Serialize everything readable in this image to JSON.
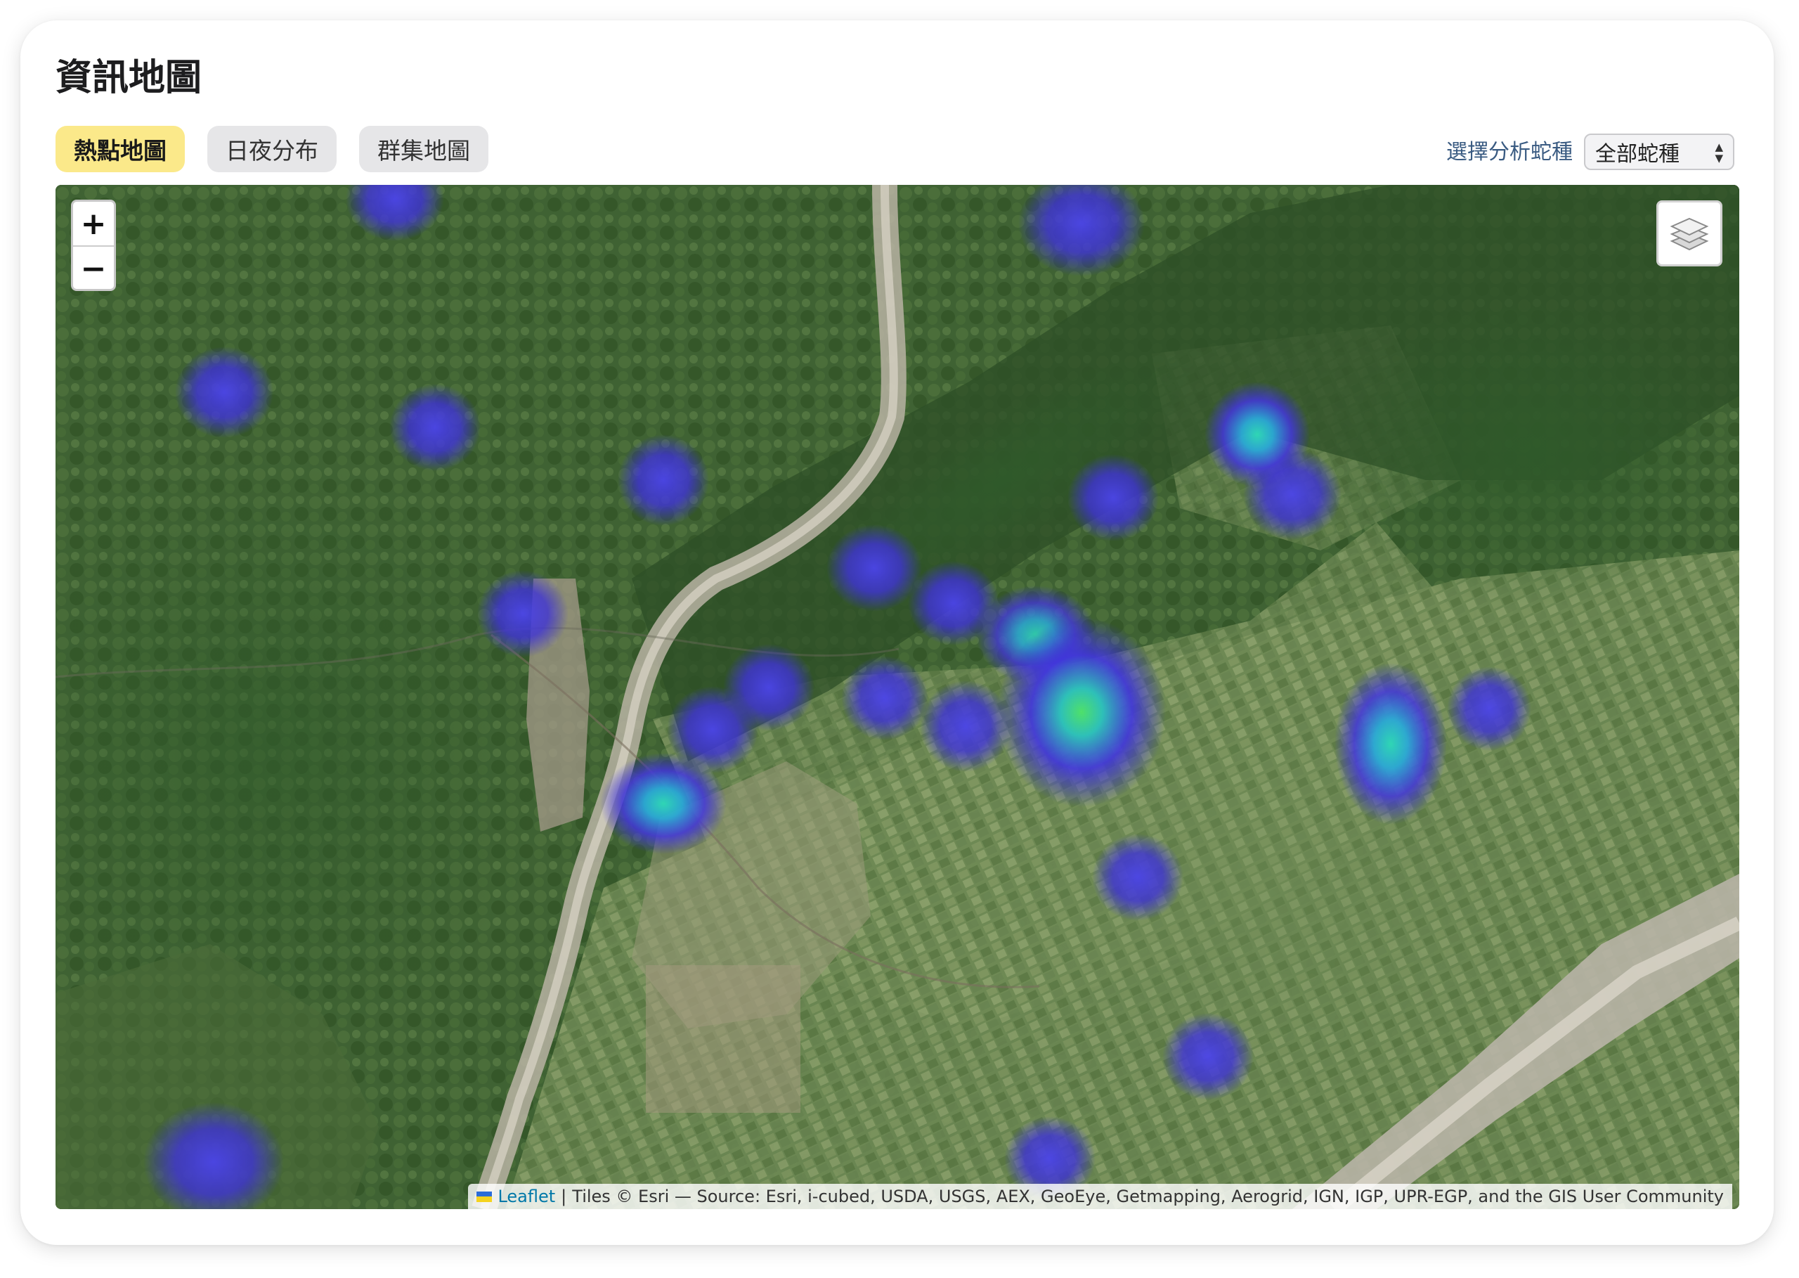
{
  "page": {
    "title": "資訊地圖"
  },
  "tabs": [
    {
      "label": "熱點地圖",
      "active": true
    },
    {
      "label": "日夜分布",
      "active": false
    },
    {
      "label": "群集地圖",
      "active": false
    }
  ],
  "filter": {
    "label": "選擇分析蛇種",
    "selected": "全部蛇種"
  },
  "map": {
    "zoom_in": "+",
    "zoom_out": "−",
    "layers_icon": "layers-icon",
    "attribution": {
      "flag_icon": "ukraine-flag-icon",
      "link": "Leaflet",
      "separator": "|",
      "text": "Tiles © Esri — Source: Esri, i-cubed, USDA, USGS, AEX, GeoEye, Getmapping, Aerogrid, IGN, IGP, UPR-EGP, and the GIS User Community"
    }
  },
  "colors": {
    "active_tab": "#fbe98a",
    "tab": "#e6e6e8",
    "label": "#3a5b82",
    "heat_low": "#3a2fd8",
    "heat_mid": "#2bb6c9",
    "heat_high": "#4ee06a"
  }
}
